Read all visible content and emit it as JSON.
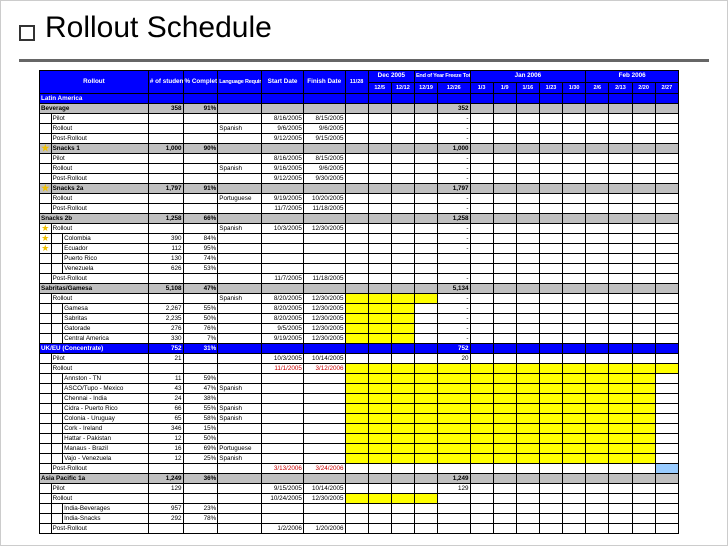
{
  "title": "Rollout Schedule",
  "headers": {
    "col1": "Rollout",
    "col2": "# of students",
    "col3": "% Complete",
    "col4": "Language Required (other than English)",
    "col5": "Start Date",
    "col6": "Finish Date",
    "c7": "11/28",
    "dec": "Dec 2005",
    "d1": "12/5",
    "d2": "12/12",
    "eoy": "End of Year Freeze Total",
    "e1": "12/19",
    "e2": "12/26",
    "jan": "Jan 2006",
    "j1": "1/3",
    "j2": "1/9",
    "j3": "1/16",
    "j4": "1/23",
    "j5": "1/30",
    "feb": "Feb 2006",
    "f1": "2/6",
    "f2": "2/13",
    "f3": "2/20",
    "f4": "2/27"
  },
  "rows": [
    {
      "type": "region",
      "name": "Latin America"
    },
    {
      "type": "section",
      "name": "Beverage",
      "students": "358",
      "pct": "91%",
      "eoy": "352"
    },
    {
      "type": "item",
      "name": "Pilot",
      "start": "8/16/2005",
      "finish": "8/15/2005",
      "eoy": "-"
    },
    {
      "type": "item",
      "name": "Rollout",
      "lang": "Spanish",
      "start": "9/6/2005",
      "finish": "9/6/2005",
      "eoy": "-"
    },
    {
      "type": "item",
      "name": "Post-Rollout",
      "start": "9/12/2005",
      "finish": "9/15/2005",
      "eoy": "-"
    },
    {
      "type": "section",
      "name": "Snacks 1",
      "students": "1,000",
      "pct": "90%",
      "eoy": "1,000",
      "star": true
    },
    {
      "type": "item",
      "name": "Pilot",
      "start": "8/16/2005",
      "finish": "8/15/2005",
      "eoy": "-"
    },
    {
      "type": "item",
      "name": "Rollout",
      "lang": "Spanish",
      "start": "9/16/2005",
      "finish": "9/6/2005",
      "eoy": "-"
    },
    {
      "type": "item",
      "name": "Post-Rollout",
      "start": "9/12/2005",
      "finish": "9/30/2005",
      "eoy": "-"
    },
    {
      "type": "section",
      "name": "Snacks 2a",
      "students": "1,797",
      "pct": "91%",
      "eoy": "1,797",
      "star": true
    },
    {
      "type": "item",
      "name": "Rollout",
      "lang": "Portuguese",
      "start": "9/19/2005",
      "finish": "10/20/2005",
      "eoy": "-"
    },
    {
      "type": "item",
      "name": "Post-Rollout",
      "start": "11/7/2005",
      "finish": "11/18/2005",
      "eoy": "-"
    },
    {
      "type": "section",
      "name": "Snacks 2b",
      "students": "1,258",
      "pct": "66%",
      "eoy": "1,258"
    },
    {
      "type": "item",
      "name": "Rollout",
      "lang": "Spanish",
      "start": "10/3/2005",
      "finish": "12/30/2005",
      "eoy": "-",
      "star": true
    },
    {
      "type": "item",
      "name": "Colombia",
      "students": "390",
      "pct": "84%",
      "eoy": "-",
      "star": true,
      "indent": 2
    },
    {
      "type": "item",
      "name": "Ecuador",
      "students": "112",
      "pct": "95%",
      "eoy": "-",
      "star": true,
      "indent": 2
    },
    {
      "type": "item",
      "name": "Puerto Rico",
      "students": "130",
      "pct": "74%",
      "indent": 2
    },
    {
      "type": "item",
      "name": "Venezuela",
      "students": "626",
      "pct": "53%",
      "indent": 2
    },
    {
      "type": "item",
      "name": "Post-Rollout",
      "start": "11/7/2005",
      "finish": "11/18/2005",
      "eoy": "-"
    },
    {
      "type": "section",
      "name": "Sabritas/Gamesa",
      "students": "5,108",
      "pct": "47%",
      "eoy": "5,134"
    },
    {
      "type": "item",
      "name": "Rollout",
      "lang": "Spanish",
      "start": "8/20/2005",
      "finish": "12/30/2005",
      "eoy": "-",
      "yellow": true
    },
    {
      "type": "item",
      "name": "Gamesa",
      "students": "2,267",
      "pct": "55%",
      "start": "8/20/2005",
      "finish": "12/30/2005",
      "eoy": "-",
      "indent": 2,
      "yellow": true
    },
    {
      "type": "item",
      "name": "Sabritas",
      "students": "2,235",
      "pct": "50%",
      "start": "8/20/2005",
      "finish": "12/30/2005",
      "eoy": "-",
      "indent": 2,
      "yellow": true
    },
    {
      "type": "item",
      "name": "Gatorade",
      "students": "276",
      "pct": "76%",
      "start": "9/5/2005",
      "finish": "12/30/2005",
      "eoy": "-",
      "indent": 2,
      "yellow": true
    },
    {
      "type": "item",
      "name": "Central America",
      "students": "330",
      "pct": "7%",
      "start": "9/19/2005",
      "finish": "12/30/2005",
      "eoy": "-",
      "indent": 2,
      "yellow": true
    },
    {
      "type": "region",
      "name": "UK/EU (Concentrate)",
      "students": "752",
      "pct": "31%",
      "eoy": "752"
    },
    {
      "type": "item",
      "name": "Pilot",
      "students": "21",
      "start": "10/3/2005",
      "finish": "10/14/2005",
      "eoy": "20"
    },
    {
      "type": "item",
      "name": "Rollout",
      "start": "11/1/2005",
      "finish": "3/12/2006",
      "red": true,
      "yellow": true
    },
    {
      "type": "item",
      "name": "Annston - TN",
      "students": "11",
      "pct": "59%",
      "indent": 2,
      "yellow": true
    },
    {
      "type": "item",
      "name": "ASCO/Tupo - Mexico",
      "students": "43",
      "pct": "47%",
      "lang": "Spanish",
      "indent": 2,
      "yellow": true
    },
    {
      "type": "item",
      "name": "Chennai - India",
      "students": "24",
      "pct": "38%",
      "indent": 2,
      "yellow": true
    },
    {
      "type": "item",
      "name": "Cidra - Puerto Rico",
      "students": "66",
      "pct": "55%",
      "lang": "Spanish",
      "indent": 2,
      "yellow": true
    },
    {
      "type": "item",
      "name": "Colonia - Uruguay",
      "students": "65",
      "pct": "58%",
      "lang": "Spanish",
      "indent": 2,
      "yellow": true
    },
    {
      "type": "item",
      "name": "Cork - Ireland",
      "students": "346",
      "pct": "15%",
      "indent": 2,
      "yellow": true
    },
    {
      "type": "item",
      "name": "Hattar - Pakistan",
      "students": "12",
      "pct": "50%",
      "indent": 2,
      "yellow": true
    },
    {
      "type": "item",
      "name": "Manaus - Brazil",
      "students": "16",
      "pct": "69%",
      "lang": "Portuguese",
      "indent": 2,
      "yellow": true
    },
    {
      "type": "item",
      "name": "Vajo - Venezuela",
      "students": "12",
      "pct": "25%",
      "lang": "Spanish",
      "indent": 2,
      "yellow": true
    },
    {
      "type": "item",
      "name": "Post-Rollout",
      "start": "3/13/2006",
      "finish": "3/24/2006",
      "red": true,
      "bluepost": true
    },
    {
      "type": "section",
      "name": "Asia Pacific 1a",
      "students": "1,249",
      "pct": "36%",
      "eoy": "1,249"
    },
    {
      "type": "item",
      "name": "Pilot",
      "students": "129",
      "start": "9/15/2005",
      "finish": "10/14/2005",
      "eoy": "129"
    },
    {
      "type": "item",
      "name": "Rollout",
      "start": "10/24/2005",
      "finish": "12/30/2005",
      "yellow": true
    },
    {
      "type": "item",
      "name": "India-Beverages",
      "students": "957",
      "pct": "23%",
      "indent": 2
    },
    {
      "type": "item",
      "name": "India-Snacks",
      "students": "292",
      "pct": "78%",
      "indent": 2
    },
    {
      "type": "item",
      "name": "Post-Rollout",
      "start": "1/2/2006",
      "finish": "1/20/2006"
    }
  ]
}
